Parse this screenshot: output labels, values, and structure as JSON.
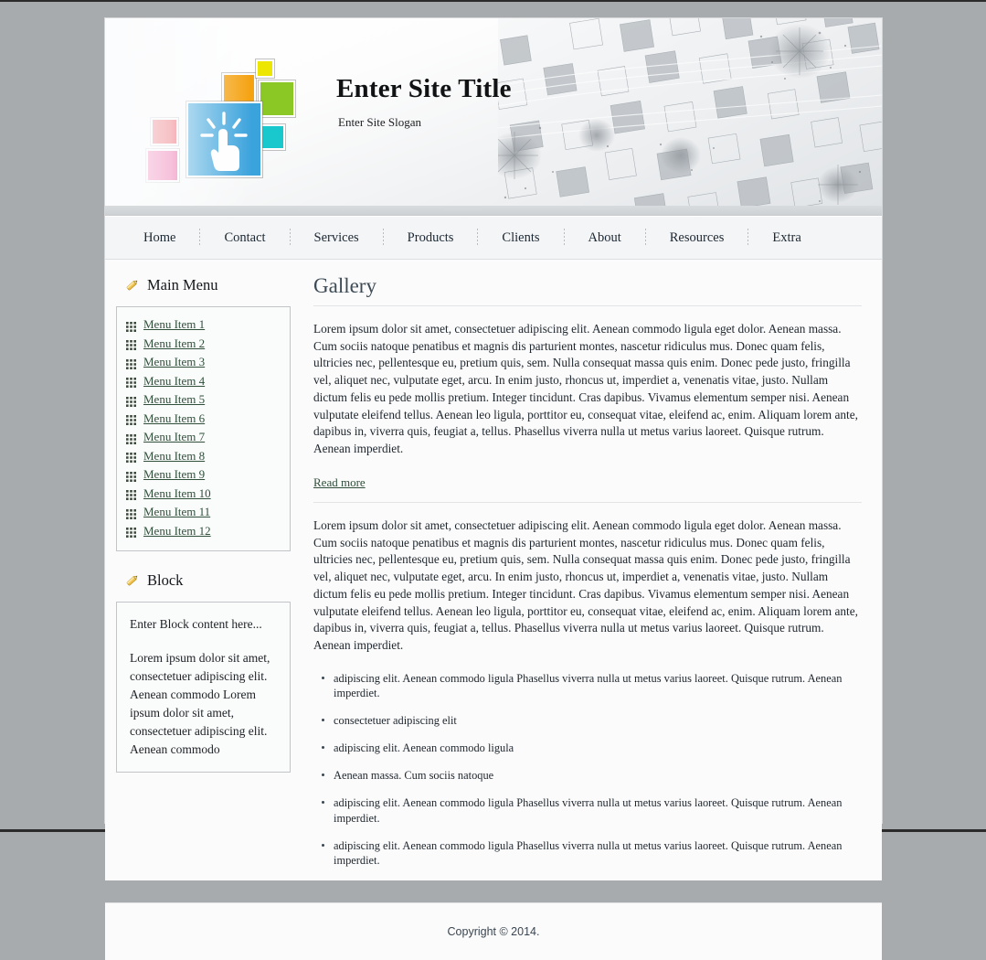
{
  "header": {
    "site_title": "Enter Site Title",
    "site_slogan": "Enter Site Slogan",
    "logo_colors": {
      "main": "#3ba3dc",
      "red": "#e8121e",
      "pink": "#ea1478",
      "orange": "#f5a210",
      "yellow": "#ece600",
      "green": "#8bc825",
      "cyan": "#18c8cd"
    }
  },
  "nav": {
    "items": [
      {
        "label": "Home"
      },
      {
        "label": "Contact"
      },
      {
        "label": "Services"
      },
      {
        "label": "Products"
      },
      {
        "label": "Clients"
      },
      {
        "label": "About"
      },
      {
        "label": "Resources"
      },
      {
        "label": "Extra"
      }
    ]
  },
  "sidebar": {
    "main_menu": {
      "title": "Main Menu",
      "icon": "pencil-icon",
      "items": [
        {
          "label": "Menu Item 1",
          "icon": "grid-handle-icon"
        },
        {
          "label": "Menu Item 2",
          "icon": "grid-handle-icon"
        },
        {
          "label": "Menu Item 3",
          "icon": "grid-handle-icon"
        },
        {
          "label": "Menu Item 4",
          "icon": "grid-handle-icon"
        },
        {
          "label": "Menu Item 5",
          "icon": "grid-handle-icon"
        },
        {
          "label": "Menu Item 6",
          "icon": "grid-handle-icon"
        },
        {
          "label": "Menu Item 7",
          "icon": "grid-handle-icon"
        },
        {
          "label": "Menu Item 8",
          "icon": "grid-handle-icon"
        },
        {
          "label": "Menu Item 9",
          "icon": "grid-handle-icon"
        },
        {
          "label": "Menu Item 10",
          "icon": "grid-handle-icon"
        },
        {
          "label": "Menu Item 11",
          "icon": "grid-handle-icon"
        },
        {
          "label": "Menu Item 12",
          "icon": "grid-handle-icon"
        }
      ]
    },
    "block": {
      "title": "Block",
      "icon": "pencil-icon",
      "placeholder_line": "Enter Block content here...",
      "body": "Lorem ipsum dolor sit amet, consectetuer adipiscing elit. Aenean commodo Lorem ipsum dolor sit amet, consectetuer adipiscing elit. Aenean commodo"
    }
  },
  "main": {
    "title": "Gallery",
    "paragraph_1": "Lorem ipsum dolor sit amet, consectetuer adipiscing elit. Aenean commodo ligula eget dolor. Aenean massa. Cum sociis natoque penatibus et magnis dis parturient montes, nascetur ridiculus mus. Donec quam felis, ultricies nec, pellentesque eu, pretium quis, sem. Nulla consequat massa quis enim. Donec pede justo, fringilla vel, aliquet nec, vulputate eget, arcu. In enim justo, rhoncus ut, imperdiet a, venenatis vitae, justo. Nullam dictum felis eu pede mollis pretium. Integer tincidunt. Cras dapibus. Vivamus elementum semper nisi. Aenean vulputate eleifend tellus. Aenean leo ligula, porttitor eu, consequat vitae, eleifend ac, enim. Aliquam lorem ante, dapibus in, viverra quis, feugiat a, tellus. Phasellus viverra nulla ut metus varius laoreet. Quisque rutrum. Aenean imperdiet.",
    "read_more": "Read more",
    "paragraph_2": "Lorem ipsum dolor sit amet, consectetuer adipiscing elit. Aenean commodo ligula eget dolor. Aenean massa. Cum sociis natoque penatibus et magnis dis parturient montes, nascetur ridiculus mus. Donec quam felis, ultricies nec, pellentesque eu, pretium quis, sem. Nulla consequat massa quis enim. Donec pede justo, fringilla vel, aliquet nec, vulputate eget, arcu. In enim justo, rhoncus ut, imperdiet a, venenatis vitae, justo. Nullam dictum felis eu pede mollis pretium. Integer tincidunt. Cras dapibus. Vivamus elementum semper nisi. Aenean vulputate eleifend tellus. Aenean leo ligula, porttitor eu, consequat vitae, eleifend ac, enim. Aliquam lorem ante, dapibus in, viverra quis, feugiat a, tellus. Phasellus viverra nulla ut metus varius laoreet. Quisque rutrum. Aenean imperdiet.",
    "bullets": [
      "adipiscing elit. Aenean commodo ligula Phasellus viverra nulla ut metus varius laoreet. Quisque rutrum. Aenean imperdiet.",
      "consectetuer adipiscing elit",
      "adipiscing elit. Aenean commodo ligula",
      "Aenean massa. Cum sociis natoque",
      "adipiscing elit. Aenean commodo ligula Phasellus viverra nulla ut metus varius laoreet. Quisque rutrum. Aenean imperdiet.",
      "adipiscing elit. Aenean commodo ligula Phasellus viverra nulla ut metus varius laoreet. Quisque rutrum. Aenean imperdiet."
    ]
  },
  "footer": {
    "copyright": "Copyright © 2014."
  }
}
